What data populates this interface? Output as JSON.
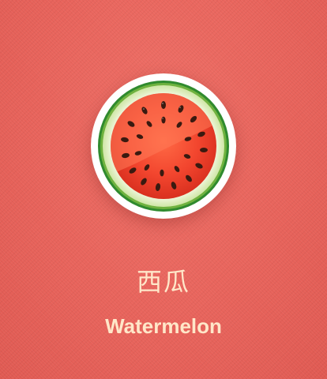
{
  "fruit": {
    "name_cn": "西瓜",
    "name_en": "Watermelon",
    "icon": "watermelon-slice-icon"
  },
  "colors": {
    "background": "#e8635b",
    "text": "#ffe7c9",
    "rind_dark": "#2f8a2e",
    "rind_light": "#d8ecb8",
    "flesh": "#f2452e",
    "seed": "#3a1a10"
  }
}
